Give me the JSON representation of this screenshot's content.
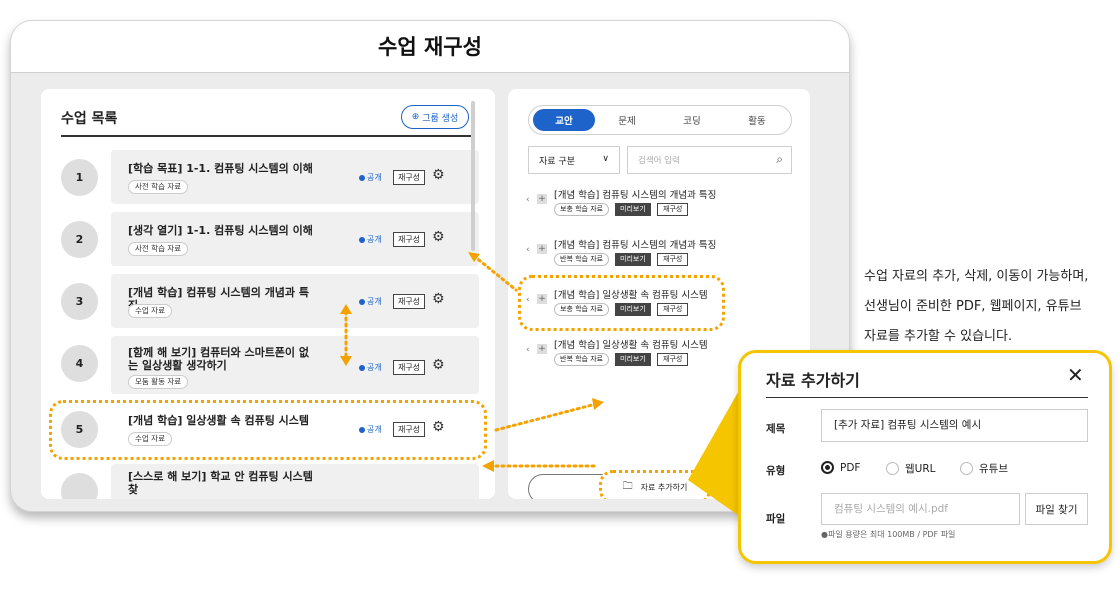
{
  "window": {
    "title": "수업 재구성"
  },
  "lesson_list": {
    "title": "수업 목록",
    "group_button": "그룹 생성",
    "items": [
      {
        "num": "1",
        "title": "[학습 목표] 1-1. 컴퓨팅 시스템의 이해",
        "tag": "사전 학습 자료",
        "public": "공개",
        "recon": "재구성"
      },
      {
        "num": "2",
        "title": "[생각 열기] 1-1. 컴퓨팅 시스템의 이해",
        "tag": "사전 학습 자료",
        "public": "공개",
        "recon": "재구성"
      },
      {
        "num": "3",
        "title": "[개념 학습] 컴퓨팅 시스템의 개념과 특징",
        "tag": "수업 자료",
        "public": "공개",
        "recon": "재구성"
      },
      {
        "num": "4",
        "title": "[함께 해 보기] 컴퓨터와 스마트폰이 없는 일상생활 생각하기",
        "tag": "모둠 활동 자료",
        "public": "공개",
        "recon": "재구성"
      },
      {
        "num": "5",
        "title": "[개념 학습] 일상생활 속 컴퓨팅 시스템",
        "tag": "수업 자료",
        "public": "공개",
        "recon": "재구성"
      },
      {
        "num": "",
        "title": "[스스로 해 보기] 학교 안 컴퓨팅 시스템 찾",
        "tag": "",
        "public": "",
        "recon": ""
      }
    ]
  },
  "materials": {
    "tabs": [
      {
        "label": "교안",
        "active": true
      },
      {
        "label": "문제",
        "active": false
      },
      {
        "label": "코딩",
        "active": false
      },
      {
        "label": "활동",
        "active": false
      }
    ],
    "filter_select": "자료 구분",
    "search_placeholder": "검색어 입력",
    "items": [
      {
        "title": "[개념 학습] 컴퓨팅 시스템의 개념과 특징",
        "tag": "보충 학습 자료",
        "preview": "미리보기",
        "recon": "재구성"
      },
      {
        "title": "[개념 학습] 컴퓨팅 시스템의 개념과 특징",
        "tag": "반복 학습 자료",
        "preview": "미리보기",
        "recon": "재구성"
      },
      {
        "title": "[개념 학습] 일상생활 속 컴퓨팅 시스템",
        "tag": "보충 학습 자료",
        "preview": "미리보기",
        "recon": "재구성"
      },
      {
        "title": "[개념 학습] 일상생활 속 컴퓨팅 시스템",
        "tag": "반복 학습 자료",
        "preview": "미리보기",
        "recon": "재구성"
      }
    ],
    "add_button": "자료 추가하기"
  },
  "callout": {
    "lines": [
      "수업 자료의 추가, 삭제, 이동이 가능하며,",
      "선생님이 준비한 PDF, 웹페이지, 유튜브",
      "자료를 추가할 수 있습니다."
    ]
  },
  "popup": {
    "title": "자료 추가하기",
    "title_label": "제목",
    "title_value": "[추가 자료] 컴퓨팅 시스템의 예시",
    "type_label": "유형",
    "types": [
      {
        "label": "PDF",
        "selected": true
      },
      {
        "label": "웹URL",
        "selected": false
      },
      {
        "label": "유튜브",
        "selected": false
      }
    ],
    "file_label": "파일",
    "file_placeholder": "컴퓨팅 시스템의 예시.pdf",
    "file_button": "파일 찾기",
    "file_hint": "●파일 용량은 최대 100MB / PDF 파일"
  },
  "colors": {
    "accent": "#1d63c9",
    "highlight": "#f5a200",
    "popup_border": "#f5c500"
  }
}
